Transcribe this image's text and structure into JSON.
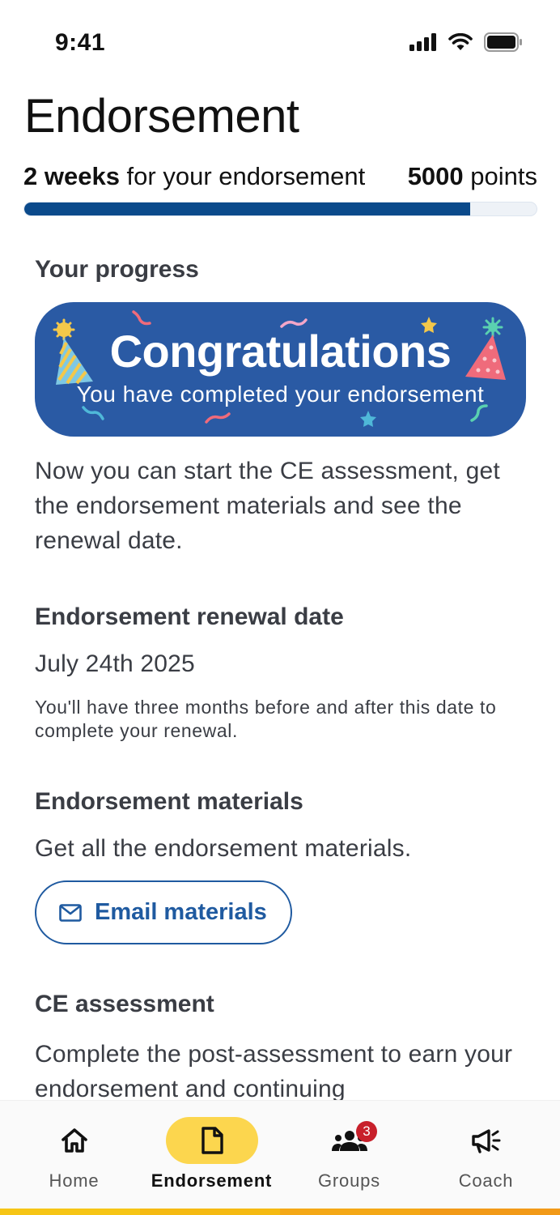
{
  "status_bar": {
    "time": "9:41"
  },
  "header": {
    "title": "Endorsement"
  },
  "progress": {
    "weeks_bold": "2 weeks",
    "weeks_text": " for your endorsement",
    "points_bold": "5000",
    "points_text": " points",
    "fraction": 0.87
  },
  "your_progress": {
    "heading": "Your progress",
    "banner_title": "Congratulations",
    "banner_subtitle": "You have completed your endorsement",
    "description": "Now you can start the CE assessment, get the endorsement materials and see the renewal date."
  },
  "renewal": {
    "heading": "Endorsement renewal date",
    "date": "July 24th 2025",
    "note": "You'll have three months before and after this date to complete your renewal."
  },
  "materials": {
    "heading": "Endorsement materials",
    "description": "Get all the endorsement materials.",
    "button_label": "Email materials",
    "button_icon": "mail-icon"
  },
  "ce_assessment": {
    "heading": "CE assessment",
    "description": "Complete the post-assessment to earn your endorsement and continuing"
  },
  "nav": {
    "items": [
      {
        "label": "Home",
        "icon": "home-icon"
      },
      {
        "label": "Endorsement",
        "icon": "document-icon",
        "active": true
      },
      {
        "label": "Groups",
        "icon": "groups-icon",
        "badge": "3"
      },
      {
        "label": "Coach",
        "icon": "megaphone-icon"
      }
    ]
  },
  "colors": {
    "primary": "#0b4a8b",
    "banner": "#2a5aa4",
    "accent_yellow": "#fcd64e",
    "badge_red": "#c8202b"
  }
}
